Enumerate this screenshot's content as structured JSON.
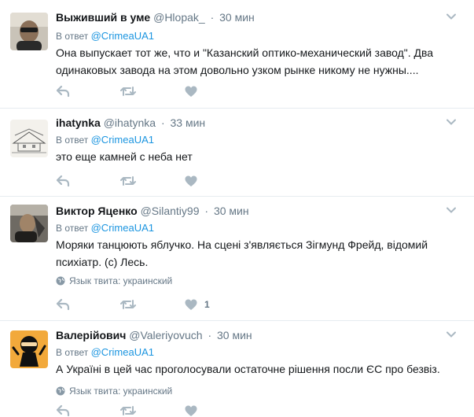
{
  "tweets": [
    {
      "name": "Выживший в уме",
      "handle": "@Hlopak_",
      "time": "30 мин",
      "reply_prefix": "В ответ",
      "reply_to": "@CrimeaUA1",
      "text": "Она выпускает тот же, что и \"Казанский оптико-механический завод\". Два одинаковых завода на этом довольно узком рынке никому не нужны....",
      "lang": "",
      "likes": ""
    },
    {
      "name": "ihatynka",
      "handle": "@ihatynka",
      "time": "33 мин",
      "reply_prefix": "В ответ",
      "reply_to": "@CrimeaUA1",
      "text": "это еще камней с неба нет",
      "lang": "",
      "likes": ""
    },
    {
      "name": "Виктор Яценко",
      "handle": "@Silantiy99",
      "time": "30 мин",
      "reply_prefix": "В ответ",
      "reply_to": "@CrimeaUA1",
      "text": "Моряки танцюють яблучко. На сцені з'являється Зігмунд Фрейд, відомий психіатр. (с) Лесь.",
      "lang": "Язык твита: украинский",
      "likes": "1"
    },
    {
      "name": "Валерійович",
      "handle": "@Valeriyovuch",
      "time": "30 мин",
      "reply_prefix": "В ответ",
      "reply_to": "@CrimeaUA1",
      "text": "А Україні в цей час проголосували остаточне рішення посли ЄС про безвіз.",
      "lang": "Язык твита: украинский",
      "likes": ""
    }
  ],
  "icons": {
    "reply": "reply-icon",
    "retweet": "retweet-icon",
    "like": "heart-icon",
    "caret": "chevron-down-icon",
    "globe": "globe-icon"
  },
  "colors": {
    "name": "#14171a",
    "meta": "#657786",
    "link": "#1b95e0",
    "icon": "#aab8c2",
    "border": "#e6ecf0"
  }
}
